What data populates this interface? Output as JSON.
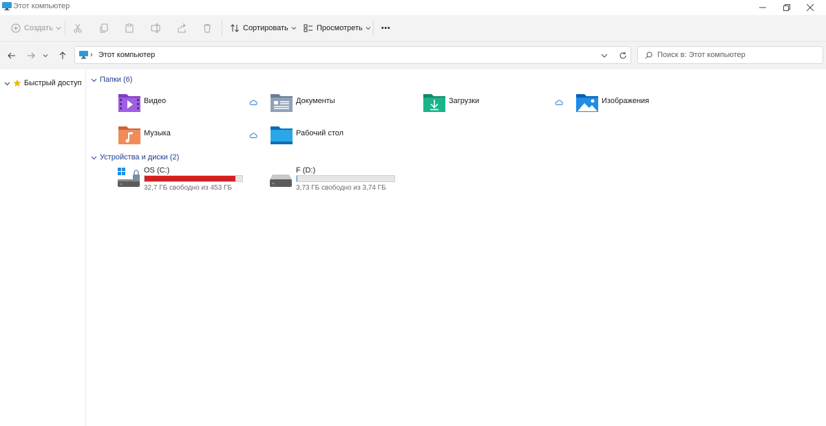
{
  "window": {
    "title": "Этот компьютер"
  },
  "toolbar": {
    "create_label": "Создать",
    "sort_label": "Сортировать",
    "view_label": "Просмотреть",
    "more_label": "•••"
  },
  "address": {
    "crumb": "Этот компьютер"
  },
  "search": {
    "placeholder": "Поиск в: Этот компьютер"
  },
  "sidebar": {
    "quick_access": "Быстрый доступ"
  },
  "sections": {
    "folders_header": "Папки (6)",
    "drives_header": "Устройства и диски (2)"
  },
  "folders": [
    {
      "name": "Видео",
      "icon": "video-folder-icon",
      "cloud": true
    },
    {
      "name": "Документы",
      "icon": "documents-folder-icon",
      "cloud": false
    },
    {
      "name": "Загрузки",
      "icon": "downloads-folder-icon",
      "cloud": true
    },
    {
      "name": "Изображения",
      "icon": "pictures-folder-icon",
      "cloud": false
    },
    {
      "name": "Музыка",
      "icon": "music-folder-icon",
      "cloud": true
    },
    {
      "name": "Рабочий стол",
      "icon": "desktop-folder-icon",
      "cloud": false
    }
  ],
  "drives": [
    {
      "name": "OS (C:)",
      "free": "32,7 ГБ свободно из 453 ГБ",
      "used_fraction": 0.928,
      "bar_color": "#d42020"
    },
    {
      "name": "F (D:)",
      "free": "3,73 ГБ свободно из 3,74 ГБ",
      "used_fraction": 0.003,
      "bar_color": "#26a0da"
    }
  ],
  "colors": {
    "accent": "#0067c0",
    "header_text": "#1f3f8c",
    "drive_full": "#d42020"
  }
}
